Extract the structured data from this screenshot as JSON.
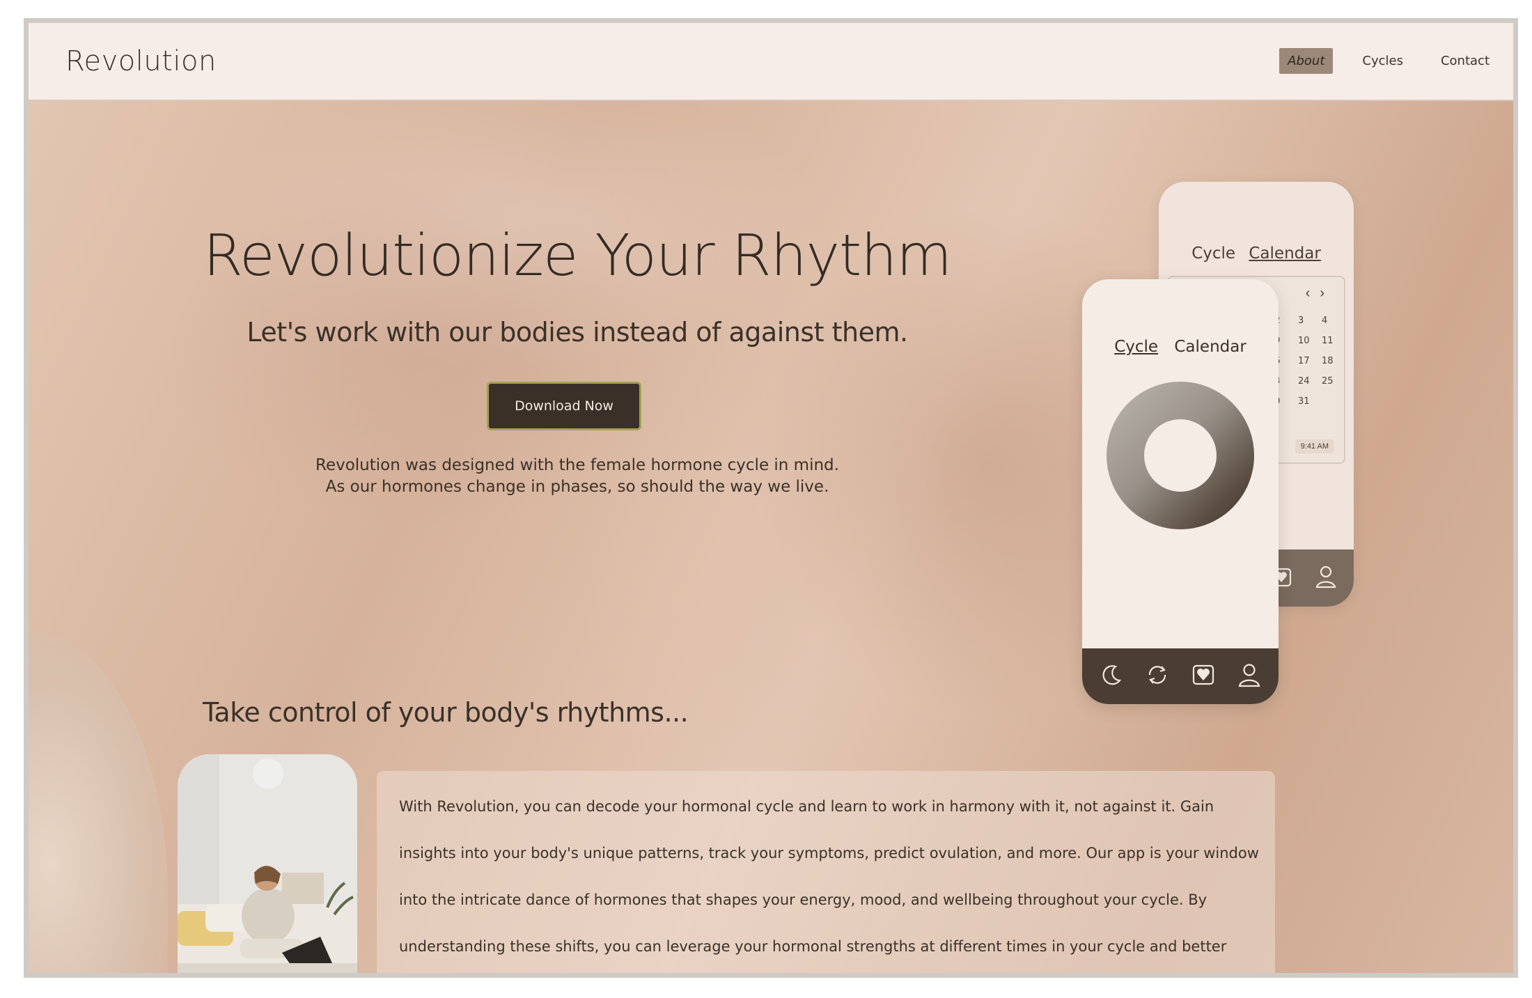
{
  "header": {
    "brand": "Revolution",
    "nav": [
      {
        "label": "About",
        "active": true
      },
      {
        "label": "Cycles",
        "active": false
      },
      {
        "label": "Contact",
        "active": false
      }
    ]
  },
  "hero": {
    "title": "Revolutionize Your Rhythm",
    "subtitle": "Let's work with our bodies instead of against them.",
    "cta": "Download Now",
    "description_line1": "Revolution was designed with the female hormone cycle in mind.",
    "description_line2": "As our hormones change in phases, so should the way we live."
  },
  "phone_back": {
    "tab_cycle": "Cycle",
    "tab_calendar": "Calendar",
    "calendar_days": [
      "2",
      "3",
      "4",
      "9",
      "10",
      "11",
      "6",
      "17",
      "18",
      "3",
      "24",
      "25",
      "0",
      "31",
      ""
    ],
    "time": "9:41 AM"
  },
  "phone_front": {
    "tab_cycle": "Cycle",
    "tab_calendar": "Calendar"
  },
  "section": {
    "title": "Take control of your body's rhythms...",
    "body": "With Revolution, you can decode your hormonal cycle and learn to work in harmony with it, not against it. Gain insights into your body's unique patterns, track your symptoms, predict ovulation, and more. Our app is your window into the intricate dance of hormones that shapes your energy, mood, and wellbeing throughout your cycle. By understanding these shifts, you can leverage your hormonal strengths at different times in your cycle and better manage challenges. It's time to embrace the power of your cycle and have your personal Revolution"
  },
  "colors": {
    "header_bg": "#f7ede8",
    "button_bg": "#3a3028",
    "button_border": "#a3a154",
    "nav_active_bg": "#9c8878",
    "phone_bar": "#4a3e34"
  },
  "icons": [
    "moon-icon",
    "cycle-arrows-icon",
    "heart-icon",
    "user-icon",
    "chevron-left-icon",
    "chevron-right-icon"
  ]
}
